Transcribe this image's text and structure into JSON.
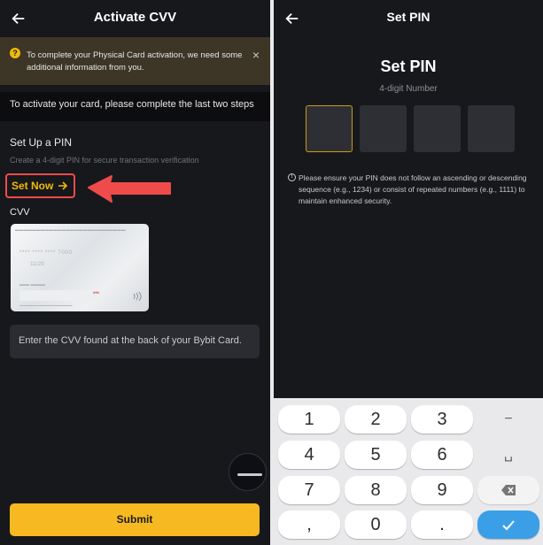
{
  "left": {
    "title": "Activate CVV",
    "notice": {
      "text": "To complete your Physical Card activation, we need some additional information from you.",
      "close_icon": "×"
    },
    "steps_text": "To activate your card, please complete the last two steps",
    "pin_section": {
      "heading": "Set Up a PIN",
      "description": "Create a 4-digit PIN for secure transaction verification",
      "set_now_label": "Set Now"
    },
    "cvv_label": "CVV",
    "card": {
      "number_masked": "**** **** **** 7000",
      "expiry": "11/29",
      "cvv_mark": "***"
    },
    "cvv_input_placeholder": "Enter the CVV found at the back of your Bybit Card.",
    "submit_label": "Submit"
  },
  "right": {
    "header_title": "Set PIN",
    "title": "Set PIN",
    "subtitle": "4-digit Number",
    "warning": "Please ensure your PIN does not follow an ascending or descending sequence (e.g., 1234) or consist of repeated numbers (e.g., 1111) to maintain enhanced security.",
    "keypad": {
      "k1": "1",
      "k2": "2",
      "k3": "3",
      "dash": "−",
      "k4": "4",
      "k5": "5",
      "k6": "6",
      "space": "␣",
      "k7": "7",
      "k8": "8",
      "k9": "9",
      "comma": ",",
      "k0": "0",
      "dot": "."
    }
  },
  "colors": {
    "accent": "#f7b922",
    "highlight": "#ef4b4b",
    "done_key": "#3b9fe8",
    "background": "#17181c"
  },
  "icons": [
    "back-arrow-icon",
    "info-icon",
    "close-icon",
    "arrow-right-icon",
    "nfc-icon",
    "backspace-icon",
    "check-icon"
  ]
}
